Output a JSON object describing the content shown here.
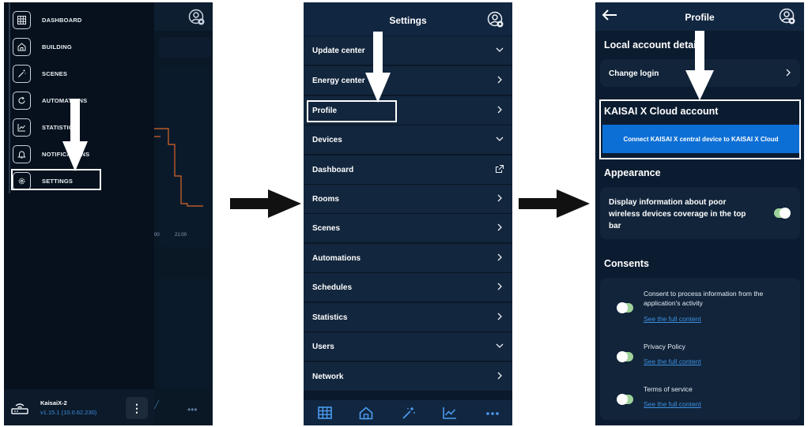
{
  "panel1": {
    "menu": [
      {
        "label": "DASHBOARD",
        "icon": "grid-icon"
      },
      {
        "label": "BUILDING",
        "icon": "home-icon"
      },
      {
        "label": "SCENES",
        "icon": "magic-wand-icon"
      },
      {
        "label": "AUTOMATIONS",
        "icon": "refresh-icon"
      },
      {
        "label": "STATISTICS",
        "icon": "chart-icon"
      },
      {
        "label": "NOTIFICATIONS",
        "icon": "bell-icon"
      },
      {
        "label": "SETTINGS",
        "icon": "gear-icon"
      }
    ],
    "highlighted": "SETTINGS",
    "device": {
      "name": "KaisaiX-2",
      "version": "v1.15.1 (10.0.62.230)"
    },
    "chart_ticks": [
      "00",
      "21:00"
    ]
  },
  "panel2": {
    "title": "Settings",
    "rows": [
      {
        "label": "Update center",
        "chevron": "down"
      },
      {
        "label": "Energy center",
        "chevron": "right"
      },
      {
        "label": "Profile",
        "chevron": "right"
      },
      {
        "label": "Devices",
        "chevron": "down"
      },
      {
        "label": "Dashboard",
        "chevron": "external"
      },
      {
        "label": "Rooms",
        "chevron": "right"
      },
      {
        "label": "Scenes",
        "chevron": "right"
      },
      {
        "label": "Automations",
        "chevron": "right"
      },
      {
        "label": "Schedules",
        "chevron": "right"
      },
      {
        "label": "Statistics",
        "chevron": "right"
      },
      {
        "label": "Users",
        "chevron": "down"
      },
      {
        "label": "Network",
        "chevron": "right"
      }
    ],
    "highlighted": "Profile",
    "bottom_nav": [
      "grid-icon",
      "home-icon",
      "magic-wand-icon",
      "chart-icon",
      "more-icon"
    ]
  },
  "panel3": {
    "title": "Profile",
    "local_section": "Local account details",
    "change_login": "Change login",
    "cloud_section": "KAISAI X Cloud account",
    "cloud_button": "Connect KAISAI X central device to KAISAI X Cloud",
    "appearance_section": "Appearance",
    "appearance_option": "Display information about poor wireless devices coverage in the top bar",
    "consents_section": "Consents",
    "consents": [
      {
        "text": "Consent to process information from the application's activity",
        "link": "See the full content"
      },
      {
        "text": "Privacy Policy",
        "link": "See the full content"
      },
      {
        "text": "Terms of service",
        "link": "See the full content"
      }
    ]
  },
  "colors": {
    "accent": "#0c6fd6",
    "link": "#3d8fe0",
    "toggle_on": "#9fd29a",
    "chart_line": "#d9662a",
    "panel_bg": "#0b1c30"
  }
}
